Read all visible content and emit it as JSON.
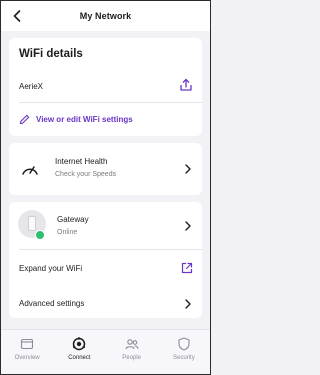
{
  "header": {
    "title": "My Network"
  },
  "wifi": {
    "section_title": "WiFi details",
    "ssid": "AerieX",
    "edit_label": "View or edit WiFi settings"
  },
  "internet_health": {
    "title": "Internet Health",
    "subtitle": "Check your Speeds"
  },
  "gateway": {
    "title": "Gateway",
    "status": "Online",
    "expand_label": "Expand your WiFi"
  },
  "advanced": {
    "label": "Advanced settings"
  },
  "bottom_nav": {
    "items": [
      {
        "label": "Overview",
        "icon": "overview-icon"
      },
      {
        "label": "Connect",
        "icon": "connect-icon"
      },
      {
        "label": "People",
        "icon": "people-icon"
      },
      {
        "label": "Security",
        "icon": "shield-icon"
      }
    ],
    "active": "Connect"
  },
  "colors": {
    "accent": "#6937c6",
    "online": "#2fbf71",
    "background": "#f2f1f6"
  }
}
